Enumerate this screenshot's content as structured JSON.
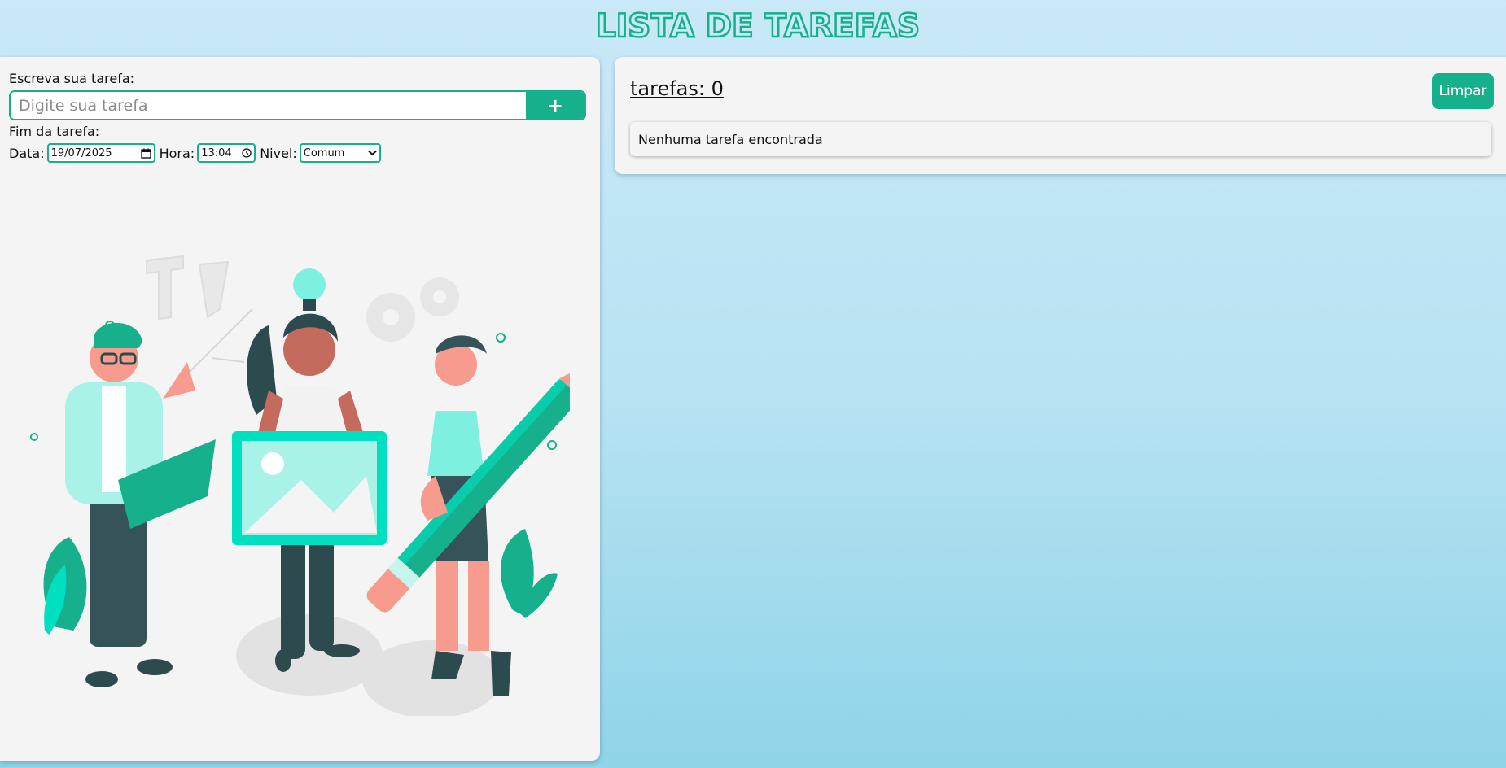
{
  "header": {
    "title": "LISTA DE TAREFAS"
  },
  "form": {
    "task_label": "Escreva sua tarefa:",
    "task_placeholder": "Digite sua tarefa",
    "task_value": "",
    "add_label": "+",
    "end_label": "Fim da tarefa:",
    "date_label": "Data:",
    "date_value": "19/07/2025",
    "time_label": "Hora:",
    "time_value": "13:04",
    "level_label": "Nivel:",
    "level_value": "Comum"
  },
  "tasks": {
    "count_label": "tarefas: 0",
    "clear_label": "Limpar",
    "empty_message": "Nenhuma tarefa encontrada"
  },
  "colors": {
    "accent": "#17b08c",
    "panel": "#f4f4f4",
    "mint": "#7ef0e0"
  },
  "icons": {
    "calendar": "calendar-icon",
    "clock": "clock-icon",
    "dropdown": "chevron-down-icon",
    "add": "plus-icon"
  }
}
